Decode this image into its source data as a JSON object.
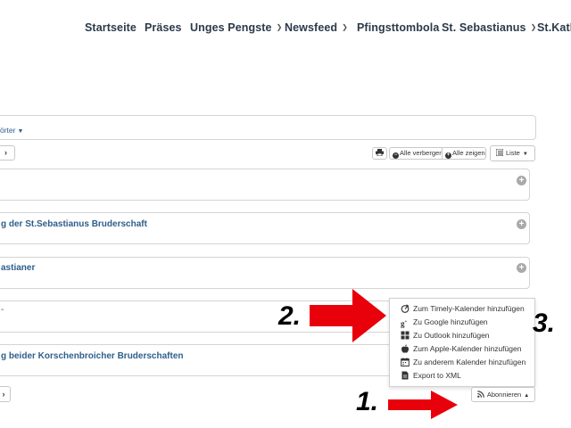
{
  "nav": {
    "items": [
      {
        "label": "Startseite",
        "has_dropdown": false
      },
      {
        "label": "Präses",
        "has_dropdown": false
      },
      {
        "label": "Unges Pengste",
        "has_dropdown": true
      },
      {
        "label": "Newsfeed",
        "has_dropdown": true
      },
      {
        "label": "Pfingsttombola",
        "has_dropdown": false
      },
      {
        "label": "St. Sebastianus",
        "has_dropdown": true
      },
      {
        "label": "St.Katha",
        "has_dropdown": false
      }
    ]
  },
  "filter": {
    "categories_label": "örter"
  },
  "pager": {
    "next_symbol": "›"
  },
  "toolbar": {
    "print_icon": "printer-icon",
    "hide_all_label": "Alle verbergen",
    "show_all_label": "Alle zeigen",
    "view_label": "Liste"
  },
  "events": [
    {
      "title": ""
    },
    {
      "title": "g der St.Sebastianus Bruderschaft"
    },
    {
      "title": "astianer"
    },
    {
      "title": "-"
    },
    {
      "title": "g beider Korschenbroicher Bruderschaften"
    }
  ],
  "dropdown": {
    "items": [
      {
        "label": "Zum Timely-Kalender hinzufügen",
        "icon": "timely-icon"
      },
      {
        "label": "Zu Google hinzufügen",
        "icon": "google-plus-icon"
      },
      {
        "label": "Zu Outlook hinzufügen",
        "icon": "windows-icon"
      },
      {
        "label": "Zum Apple-Kalender hinzufügen",
        "icon": "apple-icon"
      },
      {
        "label": "Zu anderem Kalender hinzufügen",
        "icon": "calendar-icon"
      },
      {
        "label": "Export to XML",
        "icon": "file-icon"
      }
    ]
  },
  "subscribe": {
    "label": "Abonnieren"
  },
  "annotations": {
    "one": "1.",
    "two": "2.",
    "three": "3."
  },
  "colors": {
    "accent_link": "#2d5f8a",
    "arrow_red": "#e8000b"
  }
}
